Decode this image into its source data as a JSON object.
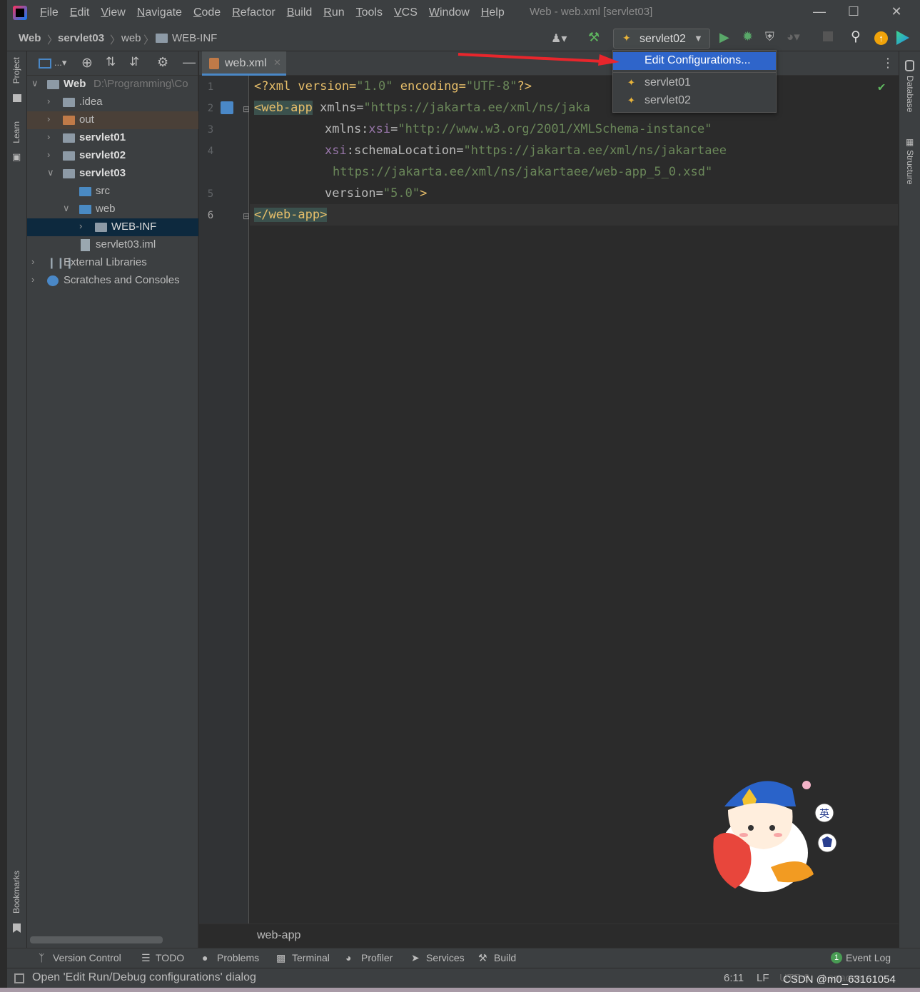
{
  "menu": [
    "File",
    "Edit",
    "View",
    "Navigate",
    "Code",
    "Refactor",
    "Build",
    "Run",
    "Tools",
    "VCS",
    "Window",
    "Help"
  ],
  "window_title": "Web - web.xml [servlet03]",
  "breadcrumb": {
    "items": [
      "Web",
      "servlet03",
      "web",
      "WEB-INF"
    ]
  },
  "run_config": {
    "selected": "servlet02"
  },
  "dropdown": {
    "items": [
      "Edit Configurations...",
      "servlet01",
      "servlet02"
    ]
  },
  "left_strip": {
    "project": "Project",
    "learn": "Learn",
    "bookmarks": "Bookmarks"
  },
  "right_strip": {
    "database": "Database",
    "structure": "Structure"
  },
  "project_tree": {
    "root_label": "Web",
    "root_path": "D:\\Programming\\Co",
    "items": [
      ".idea",
      "out",
      "servlet01",
      "servlet02",
      "servlet03",
      "src",
      "web",
      "WEB-INF",
      "servlet03.iml",
      "External Libraries",
      "Scratches and Consoles"
    ]
  },
  "editor": {
    "tab": "web.xml",
    "line_numbers": [
      "1",
      "2",
      "3",
      "4",
      "5",
      "6"
    ],
    "lines": {
      "l1a": "<?xml version=",
      "l1b": "\"1.0\"",
      "l1c": " encoding=",
      "l1d": "\"UTF-8\"",
      "l1e": "?>",
      "l2a": "<web-app",
      "l2b": " xmlns=",
      "l2c": "\"https://jakarta.ee/xml/ns/jaka",
      "l3a": "xmlns:",
      "l3b": "xsi",
      "l3c": "=",
      "l3d": "\"http://www.w3.org/2001/XMLSchema-instance\"",
      "l4a": "xsi",
      "l4b": ":schemaLocation=",
      "l4c": "\"https://jakarta.ee/xml/ns/jakartaee",
      "l4d": "https://jakarta.ee/xml/ns/jakartaee/web-app_5_0.xsd\"",
      "l5a": "version=",
      "l5b": "\"5.0\"",
      "l5c": ">",
      "l6": "</web-app>"
    },
    "breadcrumb": "web-app"
  },
  "bottom_tools": [
    "Version Control",
    "TODO",
    "Problems",
    "Terminal",
    "Profiler",
    "Services",
    "Build",
    "Event Log"
  ],
  "status": {
    "message": "Open 'Edit Run/Debug configurations' dialog",
    "position": "6:11",
    "line_sep": "LF",
    "encoding": "UTF-8",
    "indent": "4 spaces",
    "event_count": "1",
    "watermark": "CSDN @m0_63161054"
  },
  "mascot_labels": {
    "lang": "英"
  },
  "colors": {
    "accent": "#2f65ca",
    "tag": "#e8bf6a",
    "string": "#6a8759",
    "annotation_arrow": "#e8262c"
  }
}
